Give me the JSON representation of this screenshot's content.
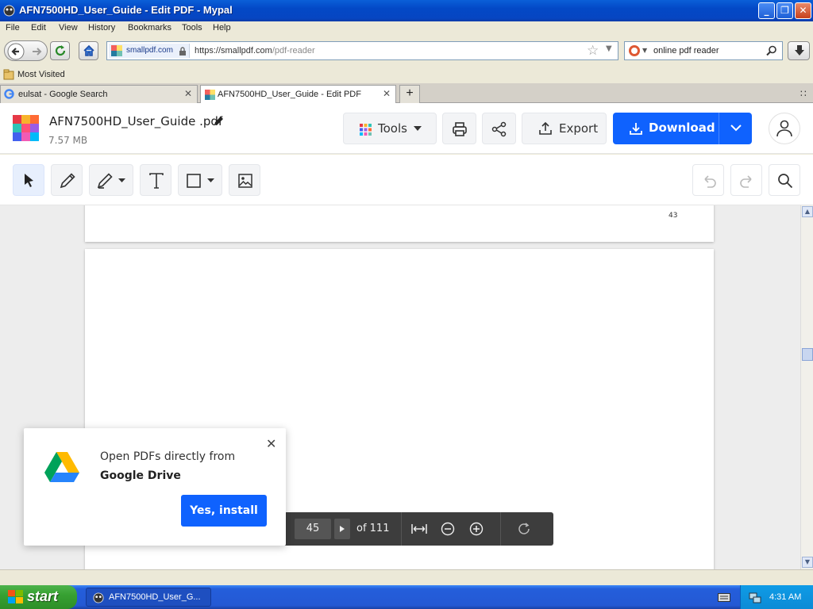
{
  "window": {
    "title": "AFN7500HD_User_Guide - Edit PDF - Mypal"
  },
  "menu": [
    "File",
    "Edit",
    "View",
    "History",
    "Bookmarks",
    "Tools",
    "Help"
  ],
  "nav": {
    "site_badge": "smallpdf.com",
    "url_host": "https://smallpdf.com",
    "url_path": "/pdf-reader",
    "search_query": "online pdf reader"
  },
  "bookmarks": {
    "most_visited": "Most Visited"
  },
  "tabs": [
    {
      "label": "eulsat - Google Search",
      "active": false
    },
    {
      "label": "AFN7500HD_User_Guide - Edit PDF",
      "active": true
    }
  ],
  "app": {
    "file_name": "AFN7500HD_User_Guide .pdf",
    "file_size": "7.57 MB",
    "tools_label": "Tools",
    "export_label": "Export",
    "download_label": "Download"
  },
  "viewer": {
    "prev_page_number": "43",
    "current_page": "45",
    "total_pages_label": "of 111"
  },
  "popup": {
    "line1": "Open PDFs directly from",
    "line2": "Google Drive",
    "install_label": "Yes, install"
  },
  "taskbar": {
    "start_label": "start",
    "task_label": "AFN7500HD_User_G...",
    "clock": "4:31 AM"
  },
  "colors": {
    "accent": "#0f62fe",
    "xp_blue": "#245edb",
    "xp_green": "#37a132"
  }
}
